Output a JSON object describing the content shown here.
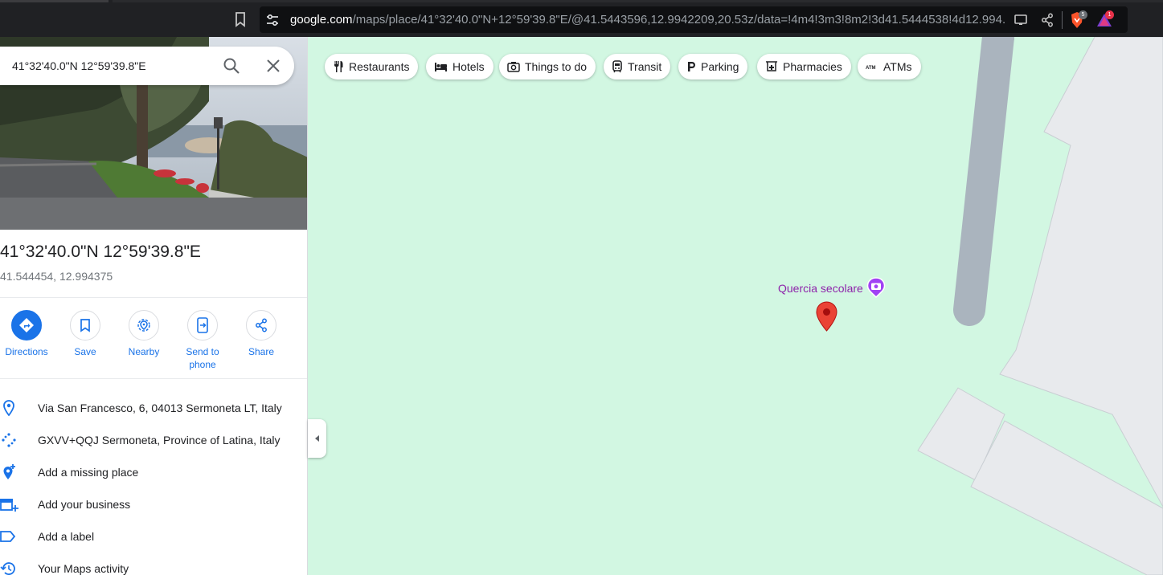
{
  "browser": {
    "url_host": "google.com",
    "url_path": "/maps/place/41°32'40.0\"N+12°59'39.8\"E/@41.5443596,12.9942209,20.53z/data=!4m4!3m3!8m2!3d41.5444538!4d12.994...",
    "brave_badge": "5",
    "rewards_badge": "1",
    "icons": [
      "bookmark-icon",
      "site-info-icon",
      "cast-icon",
      "share-icon",
      "brave-shields-icon",
      "brave-rewards-icon"
    ]
  },
  "search": {
    "query": "41°32'40.0\"N 12°59'39.8\"E"
  },
  "place": {
    "title": "41°32'40.0\"N 12°59'39.8\"E",
    "coordinates": "41.544454, 12.994375"
  },
  "actions": [
    {
      "label": "Directions",
      "icon": "directions-icon"
    },
    {
      "label": "Save",
      "icon": "bookmark-icon"
    },
    {
      "label": "Nearby",
      "icon": "nearby-icon"
    },
    {
      "label": "Send to\nphone",
      "icon": "send-to-phone-icon"
    },
    {
      "label": "Share",
      "icon": "share-icon"
    }
  ],
  "info_rows": [
    {
      "text": "Via San Francesco, 6, 04013 Sermoneta LT, Italy",
      "icon": "location-pin-icon"
    },
    {
      "text": "GXVV+QQJ Sermoneta, Province of Latina, Italy",
      "icon": "plus-code-icon"
    },
    {
      "text": "Add a missing place",
      "icon": "add-place-icon"
    },
    {
      "text": "Add your business",
      "icon": "add-business-icon"
    },
    {
      "text": "Add a label",
      "icon": "label-icon"
    },
    {
      "text": "Your Maps activity",
      "icon": "history-icon"
    }
  ],
  "chips": [
    {
      "label": "Restaurants",
      "icon": "restaurant-icon"
    },
    {
      "label": "Hotels",
      "icon": "hotel-icon"
    },
    {
      "label": "Things to do",
      "icon": "camera-icon"
    },
    {
      "label": "Transit",
      "icon": "transit-icon"
    },
    {
      "label": "Parking",
      "icon": "parking-icon"
    },
    {
      "label": "Pharmacies",
      "icon": "pharmacy-icon"
    },
    {
      "label": "ATMs",
      "icon": "atm-icon"
    }
  ],
  "map": {
    "poi_label": "Quercia secolare",
    "colors": {
      "park": "#d2f7e2",
      "building": "#e8eaed",
      "road": "#aab4be",
      "pin": "#ea4335",
      "poi": "#8e24aa",
      "accent": "#1a73e8"
    }
  }
}
